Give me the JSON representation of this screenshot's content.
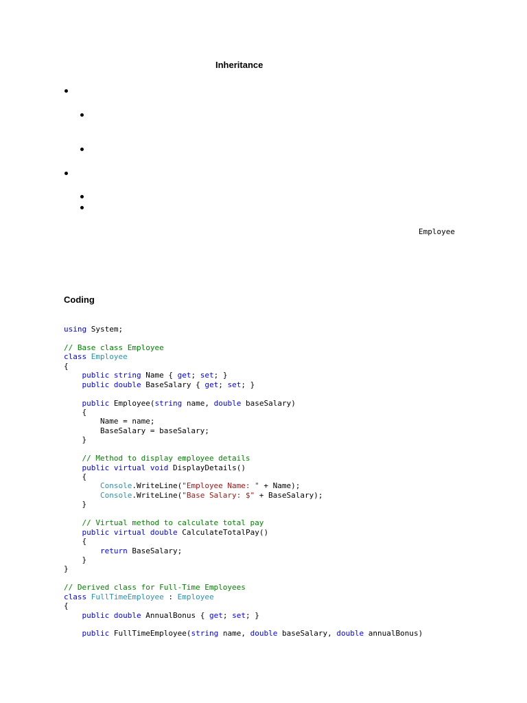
{
  "document": {
    "title": "Inheritance",
    "type_label": "Employee",
    "coding_heading": "Coding"
  },
  "bullets": [
    {
      "level": 1
    },
    {
      "level": 2
    },
    {
      "level": 2
    },
    {
      "level": 1
    },
    {
      "level": 2
    },
    {
      "level": 2
    }
  ],
  "code": {
    "colors": {
      "keyword": "#0000ff",
      "type": "#2b91af",
      "comment": "#008000",
      "string": "#a31515",
      "plain": "#000000"
    },
    "lines": [
      [
        {
          "k": "k",
          "t": "using"
        },
        {
          "k": "p",
          "t": " System;"
        }
      ],
      [],
      [
        {
          "k": "c",
          "t": "// Base class Employee"
        }
      ],
      [
        {
          "k": "k",
          "t": "class"
        },
        {
          "k": "p",
          "t": " "
        },
        {
          "k": "t",
          "t": "Employee"
        }
      ],
      [
        {
          "k": "p",
          "t": "{"
        }
      ],
      [
        {
          "k": "p",
          "t": "    "
        },
        {
          "k": "k",
          "t": "public"
        },
        {
          "k": "p",
          "t": " "
        },
        {
          "k": "k",
          "t": "string"
        },
        {
          "k": "p",
          "t": " Name { "
        },
        {
          "k": "k",
          "t": "get"
        },
        {
          "k": "p",
          "t": "; "
        },
        {
          "k": "k",
          "t": "set"
        },
        {
          "k": "p",
          "t": "; }"
        }
      ],
      [
        {
          "k": "p",
          "t": "    "
        },
        {
          "k": "k",
          "t": "public"
        },
        {
          "k": "p",
          "t": " "
        },
        {
          "k": "k",
          "t": "double"
        },
        {
          "k": "p",
          "t": " BaseSalary { "
        },
        {
          "k": "k",
          "t": "get"
        },
        {
          "k": "p",
          "t": "; "
        },
        {
          "k": "k",
          "t": "set"
        },
        {
          "k": "p",
          "t": "; }"
        }
      ],
      [],
      [
        {
          "k": "p",
          "t": "    "
        },
        {
          "k": "k",
          "t": "public"
        },
        {
          "k": "p",
          "t": " Employee("
        },
        {
          "k": "k",
          "t": "string"
        },
        {
          "k": "p",
          "t": " name, "
        },
        {
          "k": "k",
          "t": "double"
        },
        {
          "k": "p",
          "t": " baseSalary)"
        }
      ],
      [
        {
          "k": "p",
          "t": "    {"
        }
      ],
      [
        {
          "k": "p",
          "t": "        Name = name;"
        }
      ],
      [
        {
          "k": "p",
          "t": "        BaseSalary = baseSalary;"
        }
      ],
      [
        {
          "k": "p",
          "t": "    }"
        }
      ],
      [],
      [
        {
          "k": "p",
          "t": "    "
        },
        {
          "k": "c",
          "t": "// Method to display employee details"
        }
      ],
      [
        {
          "k": "p",
          "t": "    "
        },
        {
          "k": "k",
          "t": "public"
        },
        {
          "k": "p",
          "t": " "
        },
        {
          "k": "k",
          "t": "virtual"
        },
        {
          "k": "p",
          "t": " "
        },
        {
          "k": "k",
          "t": "void"
        },
        {
          "k": "p",
          "t": " DisplayDetails()"
        }
      ],
      [
        {
          "k": "p",
          "t": "    {"
        }
      ],
      [
        {
          "k": "p",
          "t": "        "
        },
        {
          "k": "t",
          "t": "Console"
        },
        {
          "k": "p",
          "t": ".WriteLine("
        },
        {
          "k": "s",
          "t": "\"Employee Name: \""
        },
        {
          "k": "p",
          "t": " + Name);"
        }
      ],
      [
        {
          "k": "p",
          "t": "        "
        },
        {
          "k": "t",
          "t": "Console"
        },
        {
          "k": "p",
          "t": ".WriteLine("
        },
        {
          "k": "s",
          "t": "\"Base Salary: $\""
        },
        {
          "k": "p",
          "t": " + BaseSalary);"
        }
      ],
      [
        {
          "k": "p",
          "t": "    }"
        }
      ],
      [],
      [
        {
          "k": "p",
          "t": "    "
        },
        {
          "k": "c",
          "t": "// Virtual method to calculate total pay"
        }
      ],
      [
        {
          "k": "p",
          "t": "    "
        },
        {
          "k": "k",
          "t": "public"
        },
        {
          "k": "p",
          "t": " "
        },
        {
          "k": "k",
          "t": "virtual"
        },
        {
          "k": "p",
          "t": " "
        },
        {
          "k": "k",
          "t": "double"
        },
        {
          "k": "p",
          "t": " CalculateTotalPay()"
        }
      ],
      [
        {
          "k": "p",
          "t": "    {"
        }
      ],
      [
        {
          "k": "p",
          "t": "        "
        },
        {
          "k": "k",
          "t": "return"
        },
        {
          "k": "p",
          "t": " BaseSalary;"
        }
      ],
      [
        {
          "k": "p",
          "t": "    }"
        }
      ],
      [
        {
          "k": "p",
          "t": "}"
        }
      ],
      [],
      [
        {
          "k": "c",
          "t": "// Derived class for Full-Time Employees"
        }
      ],
      [
        {
          "k": "k",
          "t": "class"
        },
        {
          "k": "p",
          "t": " "
        },
        {
          "k": "t",
          "t": "FullTimeEmployee"
        },
        {
          "k": "p",
          "t": " : "
        },
        {
          "k": "t",
          "t": "Employee"
        }
      ],
      [
        {
          "k": "p",
          "t": "{"
        }
      ],
      [
        {
          "k": "p",
          "t": "    "
        },
        {
          "k": "k",
          "t": "public"
        },
        {
          "k": "p",
          "t": " "
        },
        {
          "k": "k",
          "t": "double"
        },
        {
          "k": "p",
          "t": " AnnualBonus { "
        },
        {
          "k": "k",
          "t": "get"
        },
        {
          "k": "p",
          "t": "; "
        },
        {
          "k": "k",
          "t": "set"
        },
        {
          "k": "p",
          "t": "; }"
        }
      ],
      [],
      [
        {
          "k": "p",
          "t": "    "
        },
        {
          "k": "k",
          "t": "public"
        },
        {
          "k": "p",
          "t": " FullTimeEmployee("
        },
        {
          "k": "k",
          "t": "string"
        },
        {
          "k": "p",
          "t": " name, "
        },
        {
          "k": "k",
          "t": "double"
        },
        {
          "k": "p",
          "t": " baseSalary, "
        },
        {
          "k": "k",
          "t": "double"
        },
        {
          "k": "p",
          "t": " annualBonus)"
        }
      ]
    ]
  }
}
